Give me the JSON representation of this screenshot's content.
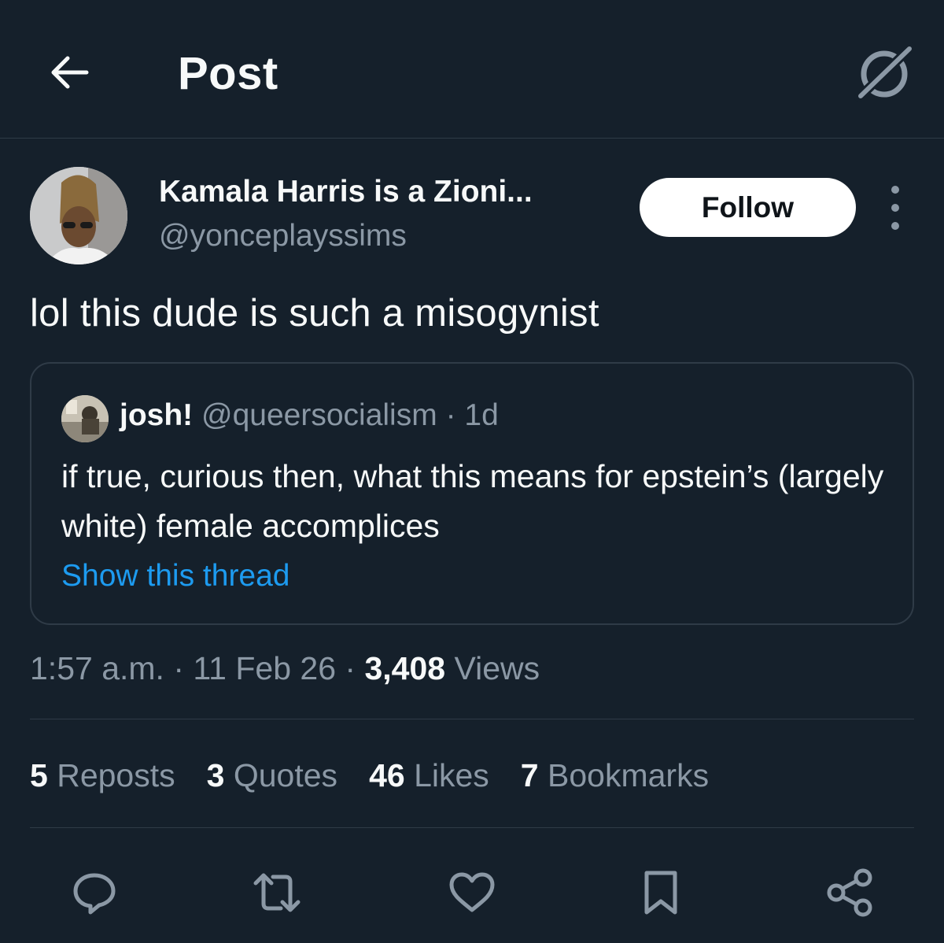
{
  "header": {
    "title": "Post",
    "back_icon": "arrow-left-icon",
    "grok_icon": "grok-icon"
  },
  "post": {
    "author_name": "Kamala Harris is a Zioni...",
    "author_handle": "@yonceplayssims",
    "follow_label": "Follow",
    "text": "lol this dude is such a misogynist",
    "quote": {
      "name": "josh!",
      "handle": "@queersocialism",
      "separator": "·",
      "time": "1d",
      "body": "if true, curious then, what this means for epstein’s (largely white) female accomplices",
      "link": "Show this thread"
    },
    "meta": {
      "time": "1:57 a.m.",
      "sep1": "·",
      "date": "11 Feb 26",
      "sep2": "·",
      "views_count": "3,408",
      "views_label": "Views"
    },
    "stats": [
      {
        "count": "5",
        "label": "Reposts"
      },
      {
        "count": "3",
        "label": "Quotes"
      },
      {
        "count": "46",
        "label": "Likes"
      },
      {
        "count": "7",
        "label": "Bookmarks"
      }
    ],
    "actions": [
      "reply-icon",
      "repost-icon",
      "like-icon",
      "bookmark-icon",
      "share-icon"
    ]
  },
  "colors": {
    "background": "#15202b",
    "text_primary": "#f7f9f9",
    "text_secondary": "#8b98a5",
    "accent": "#1d9bf0",
    "border": "#2f3b47"
  }
}
